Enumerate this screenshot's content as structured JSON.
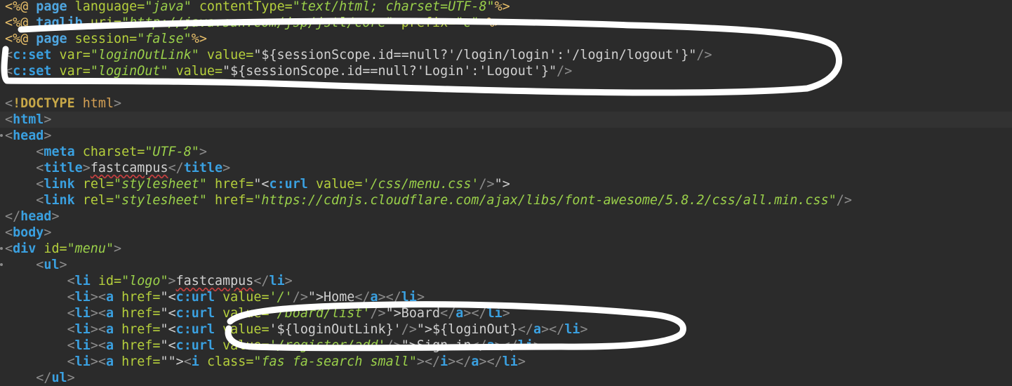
{
  "editor": {
    "lines": [
      [
        [
          "dl",
          "<%@ "
        ],
        [
          "kw",
          "page "
        ],
        [
          "at",
          "language="
        ],
        [
          "st",
          "\"java\" "
        ],
        [
          "at",
          "contentType="
        ],
        [
          "st",
          "\"text/html; charset=UTF-8\""
        ],
        [
          "dl",
          "%>"
        ]
      ],
      [
        [
          "dl",
          "<%@ "
        ],
        [
          "kw",
          "taglib "
        ],
        [
          "at",
          "uri="
        ],
        [
          "st",
          "\"http://java.sun.com/jsp/jstl/core\" "
        ],
        [
          "at",
          "prefix="
        ],
        [
          "st",
          "\"c\" "
        ],
        [
          "dl",
          "%>"
        ]
      ],
      [
        [
          "dl",
          "<%@ "
        ],
        [
          "kw",
          "page "
        ],
        [
          "at",
          "session="
        ],
        [
          "st",
          "\"false\""
        ],
        [
          "dl",
          "%>"
        ]
      ],
      [
        [
          "br",
          "<"
        ],
        [
          "tg",
          "c:set "
        ],
        [
          "at",
          "var="
        ],
        [
          "st",
          "\"loginOutLink\" "
        ],
        [
          "at",
          "value="
        ],
        [
          "pl",
          "\"${sessionScope.id==null?'/login/login':'/login/logout'}\""
        ],
        [
          "br",
          "/>"
        ]
      ],
      [
        [
          "br",
          "<"
        ],
        [
          "tg",
          "c:set "
        ],
        [
          "at",
          "var="
        ],
        [
          "st",
          "\"loginOut\" "
        ],
        [
          "at",
          "value="
        ],
        [
          "pl",
          "\"${sessionScope.id==null?'Login':'Logout'}\""
        ],
        [
          "br",
          "/>"
        ]
      ],
      [],
      [
        [
          "br",
          "<"
        ],
        [
          "dt",
          "!DOCTYPE "
        ],
        [
          "hn",
          "html"
        ],
        [
          "br",
          ">"
        ]
      ],
      [
        [
          "br",
          "<"
        ],
        [
          "tg",
          "html"
        ],
        [
          "br",
          ">"
        ]
      ],
      [
        [
          "br",
          "<"
        ],
        [
          "tg",
          "head"
        ],
        [
          "br",
          ">"
        ]
      ],
      [
        [
          "pl",
          "    "
        ],
        [
          "br",
          "<"
        ],
        [
          "tg",
          "meta "
        ],
        [
          "at",
          "charset="
        ],
        [
          "st",
          "\"UTF-8\""
        ],
        [
          "br",
          ">"
        ]
      ],
      [
        [
          "pl",
          "    "
        ],
        [
          "br",
          "<"
        ],
        [
          "tg",
          "title"
        ],
        [
          "br",
          ">"
        ],
        [
          "pl",
          "fastcampus"
        ],
        [
          "br",
          "</"
        ],
        [
          "tg",
          "title"
        ],
        [
          "br",
          ">"
        ]
      ],
      [
        [
          "pl",
          "    "
        ],
        [
          "br",
          "<"
        ],
        [
          "tg",
          "link "
        ],
        [
          "at",
          "rel="
        ],
        [
          "st",
          "\"stylesheet\" "
        ],
        [
          "at",
          "href="
        ],
        [
          "pl",
          "\"<"
        ],
        [
          "tg",
          "c:url "
        ],
        [
          "at",
          "value="
        ],
        [
          "st",
          "'/css/menu.css'"
        ],
        [
          "br",
          "/>"
        ],
        [
          "pl",
          "\">"
        ]
      ],
      [
        [
          "pl",
          "    "
        ],
        [
          "br",
          "<"
        ],
        [
          "tg",
          "link "
        ],
        [
          "at",
          "rel="
        ],
        [
          "st",
          "\"stylesheet\" "
        ],
        [
          "at",
          "href="
        ],
        [
          "st",
          "\"https://cdnjs.cloudflare.com/ajax/libs/font-awesome/5.8.2/css/all.min.css\""
        ],
        [
          "br",
          "/>"
        ]
      ],
      [
        [
          "br",
          "</"
        ],
        [
          "tg",
          "head"
        ],
        [
          "br",
          ">"
        ]
      ],
      [
        [
          "br",
          "<"
        ],
        [
          "tg",
          "body"
        ],
        [
          "br",
          ">"
        ]
      ],
      [
        [
          "br",
          "<"
        ],
        [
          "tg",
          "div "
        ],
        [
          "at",
          "id="
        ],
        [
          "st",
          "\"menu\""
        ],
        [
          "br",
          ">"
        ]
      ],
      [
        [
          "pl",
          "    "
        ],
        [
          "br",
          "<"
        ],
        [
          "tg",
          "ul"
        ],
        [
          "br",
          ">"
        ]
      ],
      [
        [
          "pl",
          "        "
        ],
        [
          "br",
          "<"
        ],
        [
          "tg",
          "li "
        ],
        [
          "at",
          "id="
        ],
        [
          "st",
          "\"logo\""
        ],
        [
          "br",
          ">"
        ],
        [
          "pl",
          "fastcampus"
        ],
        [
          "br",
          "</"
        ],
        [
          "tg",
          "li"
        ],
        [
          "br",
          ">"
        ]
      ],
      [
        [
          "pl",
          "        "
        ],
        [
          "br",
          "<"
        ],
        [
          "tg",
          "li"
        ],
        [
          "br",
          "><"
        ],
        [
          "tg",
          "a "
        ],
        [
          "at",
          "href="
        ],
        [
          "pl",
          "\"<"
        ],
        [
          "tg",
          "c:url "
        ],
        [
          "at",
          "value="
        ],
        [
          "st",
          "'/'"
        ],
        [
          "br",
          "/>"
        ],
        [
          "pl",
          "\">Home"
        ],
        [
          "br",
          "</"
        ],
        [
          "tg",
          "a"
        ],
        [
          "br",
          "></"
        ],
        [
          "tg",
          "li"
        ],
        [
          "br",
          ">"
        ]
      ],
      [
        [
          "pl",
          "        "
        ],
        [
          "br",
          "<"
        ],
        [
          "tg",
          "li"
        ],
        [
          "br",
          "><"
        ],
        [
          "tg",
          "a "
        ],
        [
          "at",
          "href="
        ],
        [
          "pl",
          "\"<"
        ],
        [
          "tg",
          "c:url "
        ],
        [
          "at",
          "value="
        ],
        [
          "st",
          "'/board/list'"
        ],
        [
          "br",
          "/>"
        ],
        [
          "pl",
          "\">Board"
        ],
        [
          "br",
          "</"
        ],
        [
          "tg",
          "a"
        ],
        [
          "br",
          "></"
        ],
        [
          "tg",
          "li"
        ],
        [
          "br",
          ">"
        ]
      ],
      [
        [
          "pl",
          "        "
        ],
        [
          "br",
          "<"
        ],
        [
          "tg",
          "li"
        ],
        [
          "br",
          "><"
        ],
        [
          "tg",
          "a "
        ],
        [
          "at",
          "href="
        ],
        [
          "pl",
          "\"<"
        ],
        [
          "tg",
          "c:url "
        ],
        [
          "at",
          "value="
        ],
        [
          "pl",
          "'${loginOutLink}'"
        ],
        [
          "br",
          "/>"
        ],
        [
          "pl",
          "\">${loginOut}"
        ],
        [
          "br",
          "</"
        ],
        [
          "tg",
          "a"
        ],
        [
          "br",
          "></"
        ],
        [
          "tg",
          "li"
        ],
        [
          "br",
          ">"
        ]
      ],
      [
        [
          "pl",
          "        "
        ],
        [
          "br",
          "<"
        ],
        [
          "tg",
          "li"
        ],
        [
          "br",
          "><"
        ],
        [
          "tg",
          "a "
        ],
        [
          "at",
          "href="
        ],
        [
          "pl",
          "\"<"
        ],
        [
          "tg",
          "c:url "
        ],
        [
          "at",
          "value="
        ],
        [
          "st",
          "'/register/add'"
        ],
        [
          "br",
          "/>"
        ],
        [
          "pl",
          "\">Sign in"
        ],
        [
          "br",
          "</"
        ],
        [
          "tg",
          "a"
        ],
        [
          "br",
          "></"
        ],
        [
          "tg",
          "li"
        ],
        [
          "br",
          ">"
        ]
      ],
      [
        [
          "pl",
          "        "
        ],
        [
          "br",
          "<"
        ],
        [
          "tg",
          "li"
        ],
        [
          "br",
          "><"
        ],
        [
          "tg",
          "a "
        ],
        [
          "at",
          "href="
        ],
        [
          "pl",
          "\"\">"
        ],
        [
          "br",
          "<"
        ],
        [
          "tg",
          "i "
        ],
        [
          "at",
          "class="
        ],
        [
          "st",
          "\"fas fa-search small\""
        ],
        [
          "br",
          "></"
        ],
        [
          "tg",
          "i"
        ],
        [
          "br",
          "></"
        ],
        [
          "tg",
          "a"
        ],
        [
          "br",
          "></"
        ],
        [
          "tg",
          "li"
        ],
        [
          "br",
          ">"
        ]
      ],
      [
        [
          "pl",
          "    "
        ],
        [
          "br",
          "</"
        ],
        [
          "tg",
          "ul"
        ],
        [
          "br",
          ">"
        ]
      ]
    ]
  }
}
